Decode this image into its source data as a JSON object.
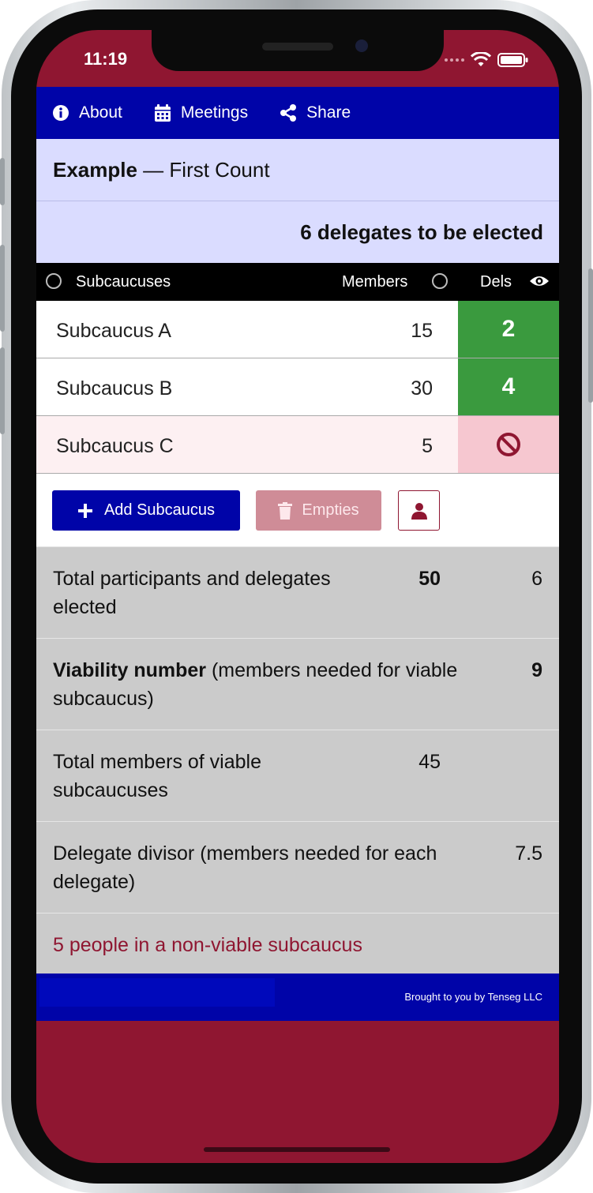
{
  "status_bar": {
    "time": "11:19"
  },
  "nav": {
    "about": "About",
    "meetings": "Meetings",
    "share": "Share"
  },
  "header": {
    "meeting_name": "Example",
    "separator": " — ",
    "count_label": "First Count",
    "delegates_to_elect": "6 delegates to be elected"
  },
  "table": {
    "col_subcaucuses": "Subcaucuses",
    "col_members": "Members",
    "col_dels": "Dels",
    "rows": [
      {
        "name": "Subcaucus A",
        "members": "15",
        "dels": "2",
        "viable": true
      },
      {
        "name": "Subcaucus B",
        "members": "30",
        "dels": "4",
        "viable": true
      },
      {
        "name": "Subcaucus C",
        "members": "5",
        "dels": "",
        "viable": false
      }
    ]
  },
  "actions": {
    "add_subcaucus": "Add Subcaucus",
    "empties": "Empties"
  },
  "summary": {
    "total_label": "Total participants and delegates elected",
    "total_participants": "50",
    "total_delegates": "6",
    "viability_bold": "Viability number",
    "viability_rest": " (members needed for viable subcaucus)",
    "viability_value": "9",
    "viable_members_label": "Total members of viable subcaucuses",
    "viable_members_value": "45",
    "divisor_label": "Delegate divisor (members needed for each delegate)",
    "divisor_value": "7.5",
    "nonviable_note": "5 people in a non-viable subcaucus"
  },
  "footer": {
    "credit": "Brought to you by Tenseg LLC"
  },
  "colors": {
    "nav_blue": "#0004a8",
    "brand_maroon": "#8f1631",
    "viable_green": "#3a9a3e",
    "nonviable_pink": "#f6c7d0",
    "header_lavender": "#dadcff"
  }
}
